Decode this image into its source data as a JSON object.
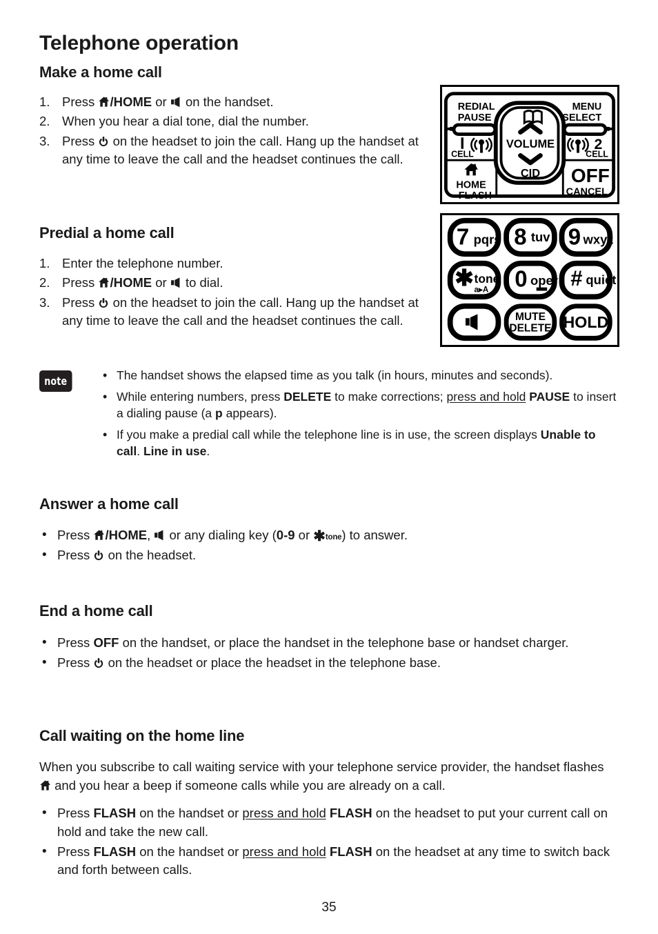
{
  "page": {
    "chapter_title": "Telephone operation",
    "page_number": "35"
  },
  "sections": {
    "make_call": {
      "heading": "Make a home call",
      "steps": [
        {
          "num": "1.",
          "pre": "Press ",
          "icon": "home-icon",
          "mid": "/HOME",
          "mid2": " or ",
          "icon2": "speaker-icon",
          "post": " on the handset."
        },
        {
          "num": "2.",
          "text": "When you hear a dial tone, dial the number."
        },
        {
          "num": "3.",
          "pre": "Press ",
          "icon": "power-icon",
          "post": " on the headset to join the call. Hang up the handset at any time to leave the call and the headset continues the call."
        }
      ]
    },
    "predial_call": {
      "heading": "Predial a home call",
      "steps": [
        {
          "num": "1.",
          "text": "Enter the telephone number."
        },
        {
          "num": "2.",
          "pre": "Press ",
          "icon": "home-icon",
          "mid": "/HOME",
          "mid2": " or ",
          "icon2": "speaker-icon",
          "post": " to dial."
        },
        {
          "num": "3.",
          "pre": "Press ",
          "icon": "power-icon",
          "post": " on the headset to join the call. Hang up the handset at any time to leave the call and the headset continues the call."
        }
      ]
    },
    "note": {
      "badge_label": "note",
      "items": [
        {
          "parts": [
            {
              "t": "The handset shows the elapsed time as you talk (in hours, minutes and seconds).",
              "s": "n"
            }
          ]
        },
        {
          "parts": [
            {
              "t": "While entering numbers, press ",
              "s": "n"
            },
            {
              "t": "DELETE",
              "s": "b"
            },
            {
              "t": " to make corrections; ",
              "s": "n"
            },
            {
              "t": "press and hold",
              "s": "u"
            },
            {
              "t": " ",
              "s": "n"
            },
            {
              "t": "PAUSE",
              "s": "b"
            },
            {
              "t": " to insert a dialing pause (a ",
              "s": "n"
            },
            {
              "t": "p",
              "s": "b"
            },
            {
              "t": " appears).",
              "s": "n"
            }
          ]
        },
        {
          "parts": [
            {
              "t": "If you make a predial call while the telephone line is in use, the screen displays ",
              "s": "n"
            },
            {
              "t": "Unable to call",
              "s": "b"
            },
            {
              "t": ". ",
              "s": "n"
            },
            {
              "t": "Line in use",
              "s": "b"
            },
            {
              "t": ".",
              "s": "n"
            }
          ]
        }
      ]
    },
    "answer_call": {
      "heading": "Answer a home call",
      "items": [
        {
          "pre": "Press ",
          "icon": "home-icon",
          "mid": "/HOME",
          "mid2": ", ",
          "icon2": "speaker-icon",
          "mid3": " or any dialing key (",
          "bold1": "0-9",
          "mid4": " or ",
          "icon3": "star-tone-icon",
          "post": ") to answer."
        },
        {
          "pre": "Press ",
          "icon": "power-icon",
          "post": " on the headset."
        }
      ]
    },
    "end_call": {
      "heading": "End a home call",
      "items": [
        {
          "pre": "Press ",
          "bold1": "OFF",
          "post": " on the handset, or place the handset in the telephone base or handset charger."
        },
        {
          "pre": "Press ",
          "icon": "power-icon",
          "post": " on the headset or place the headset in the telephone base."
        }
      ]
    },
    "call_waiting": {
      "heading": "Call waiting on the home line",
      "intro_pre": "When you subscribe to call waiting service with your telephone service provider, the handset flashes ",
      "intro_icon": "home-icon",
      "intro_post": " and you hear a beep if someone calls while you are already on a call.",
      "items": [
        {
          "parts": [
            {
              "t": "Press ",
              "s": "n"
            },
            {
              "t": "FLASH",
              "s": "b"
            },
            {
              "t": " on the handset or ",
              "s": "n"
            },
            {
              "t": "press and hold",
              "s": "u"
            },
            {
              "t": " ",
              "s": "n"
            },
            {
              "t": "FLASH",
              "s": "b"
            },
            {
              "t": " on the headset to put your current call on hold and take the new call.",
              "s": "n"
            }
          ]
        },
        {
          "parts": [
            {
              "t": "Press ",
              "s": "n"
            },
            {
              "t": "FLASH",
              "s": "b"
            },
            {
              "t": " on the handset or ",
              "s": "n"
            },
            {
              "t": "press and hold",
              "s": "u"
            },
            {
              "t": " ",
              "s": "n"
            },
            {
              "t": "FLASH",
              "s": "b"
            },
            {
              "t": " on the headset at any time to switch back and forth between calls.",
              "s": "n"
            }
          ]
        }
      ]
    }
  },
  "diagrams": {
    "nav_keypad": {
      "name": "handset-navigation-keys-diagram",
      "labels": {
        "redial": "REDIAL",
        "pause": "PAUSE",
        "menu": "MENU",
        "select": "SELECT",
        "cell_left_num": "1",
        "cell_left": "CELL",
        "cell_right_num": "2",
        "cell_right": "CELL",
        "volume": "VOLUME",
        "cid": "CID",
        "home": "HOME",
        "flash": "FLASH",
        "off": "OFF",
        "cancel": "CANCEL"
      }
    },
    "dial_keypad": {
      "name": "handset-dial-keys-diagram",
      "keys": [
        {
          "digit": "7",
          "letters": "pqrs"
        },
        {
          "digit": "8",
          "letters": "tuv"
        },
        {
          "digit": "9",
          "letters": "wxyz"
        },
        {
          "digit": "✱",
          "letters": "tone",
          "sub": "a▸A"
        },
        {
          "digit": "0",
          "letters": "oper"
        },
        {
          "digit": "#",
          "letters": "quiet"
        },
        {
          "digit": "speaker-icon",
          "letters": ""
        },
        {
          "digit": "MUTE",
          "letters": "DELETE"
        },
        {
          "digit": "HOLD",
          "letters": ""
        }
      ]
    }
  },
  "colors": {
    "ink": "#1a1a1a",
    "badge_bg": "#231f20",
    "diagram_line": "#000000"
  }
}
